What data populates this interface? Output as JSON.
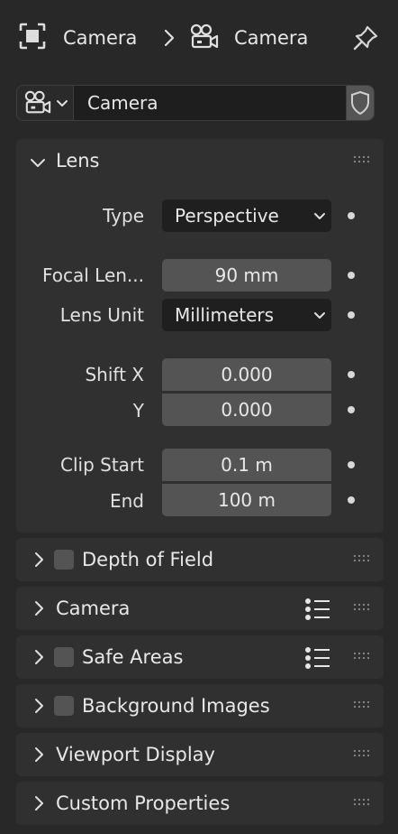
{
  "header": {
    "context_label": "Camera",
    "object_label": "Camera"
  },
  "datablock": {
    "name": "Camera"
  },
  "lens_panel": {
    "title": "Lens",
    "type_label": "Type",
    "type_value": "Perspective",
    "focal_label": "Focal Len...",
    "focal_value": "90 mm",
    "lens_unit_label": "Lens Unit",
    "lens_unit_value": "Millimeters",
    "shift_x_label": "Shift X",
    "shift_x_value": "0.000",
    "shift_y_label": "Y",
    "shift_y_value": "0.000",
    "clip_start_label": "Clip Start",
    "clip_start_value": "0.1 m",
    "clip_end_label": "End",
    "clip_end_value": "100 m"
  },
  "panels": {
    "dof": "Depth of Field",
    "camera": "Camera",
    "safe_areas": "Safe Areas",
    "background_images": "Background Images",
    "viewport_display": "Viewport Display",
    "custom_properties": "Custom Properties"
  }
}
